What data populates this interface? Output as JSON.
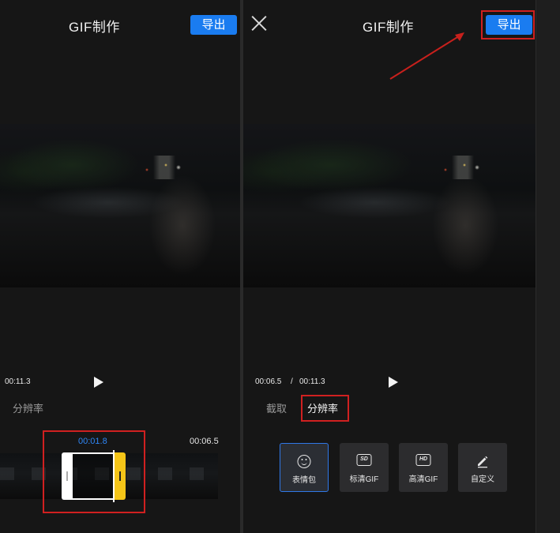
{
  "left_panel": {
    "title": "GIF制作",
    "export_label": "导出",
    "current_time_partial": "00:11.3",
    "tab_resolution": "分辨率",
    "cursor_time": "00:01.8",
    "end_time": "00:06.5"
  },
  "right_panel": {
    "title": "GIF制作",
    "export_label": "导出",
    "time_current": "00:06.5",
    "time_separator": "/",
    "time_total": "00:11.3",
    "tabs": [
      "截取",
      "分辨率"
    ],
    "active_tab": "分辨率",
    "presets": [
      {
        "label": "表情包",
        "icon": "smile-icon",
        "selected": true
      },
      {
        "label": "标清GIF",
        "icon": "sd-icon",
        "badge": "SD",
        "selected": false
      },
      {
        "label": "高清GIF",
        "icon": "hd-icon",
        "badge": "HD",
        "selected": false
      },
      {
        "label": "自定义",
        "icon": "pencil-icon",
        "selected": false
      }
    ]
  },
  "colors": {
    "accent_blue": "#1a7cf0",
    "highlight_red": "#d02020",
    "trim_yellow": "#f5c518",
    "cursor_time_blue": "#2f86f5"
  }
}
